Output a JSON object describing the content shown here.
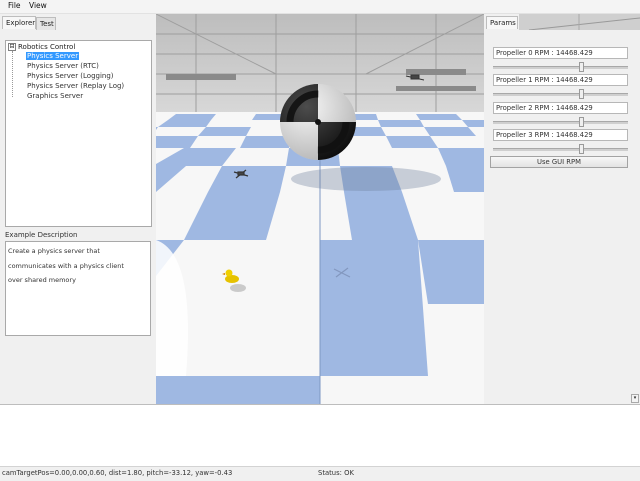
{
  "menubar": {
    "items": [
      "File",
      "View"
    ]
  },
  "left_panel": {
    "tabs": [
      "Explorer",
      "Test"
    ],
    "tree": {
      "root": "Robotics Control",
      "expander": "⊟",
      "items": [
        {
          "label": "Physics Server",
          "selected": true
        },
        {
          "label": "Physics Server (RTC)",
          "selected": false
        },
        {
          "label": "Physics Server (Logging)",
          "selected": false
        },
        {
          "label": "Physics Server (Replay Log)",
          "selected": false
        },
        {
          "label": "Graphics Server",
          "selected": false
        }
      ]
    },
    "description": {
      "label": "Example Description",
      "lines": [
        "Create a physics server that",
        "communicates with a physics client",
        "over shared memory"
      ]
    }
  },
  "right_panel": {
    "tab": "Params",
    "params": [
      {
        "label": "Propeller 0 RPM : 14468.429",
        "slider_fraction": 0.6
      },
      {
        "label": "Propeller 1 RPM : 14468.429",
        "slider_fraction": 0.6
      },
      {
        "label": "Propeller 2 RPM : 14468.429",
        "slider_fraction": 0.6
      },
      {
        "label": "Propeller 3 RPM : 14468.429",
        "slider_fraction": 0.6
      }
    ],
    "button": "Use GUI RPM",
    "scroll_icon": "▾"
  },
  "status": {
    "camera": "camTargetPos=0.00,0.00,0.60, dist=1.80, pitch=-33.12, yaw=-0.43",
    "status": "Status: OK"
  },
  "colors": {
    "floor_blue": "#9fb8e2",
    "floor_white": "#f7f7f7",
    "background": "#f0f0f0",
    "selection": "#3399ff"
  }
}
